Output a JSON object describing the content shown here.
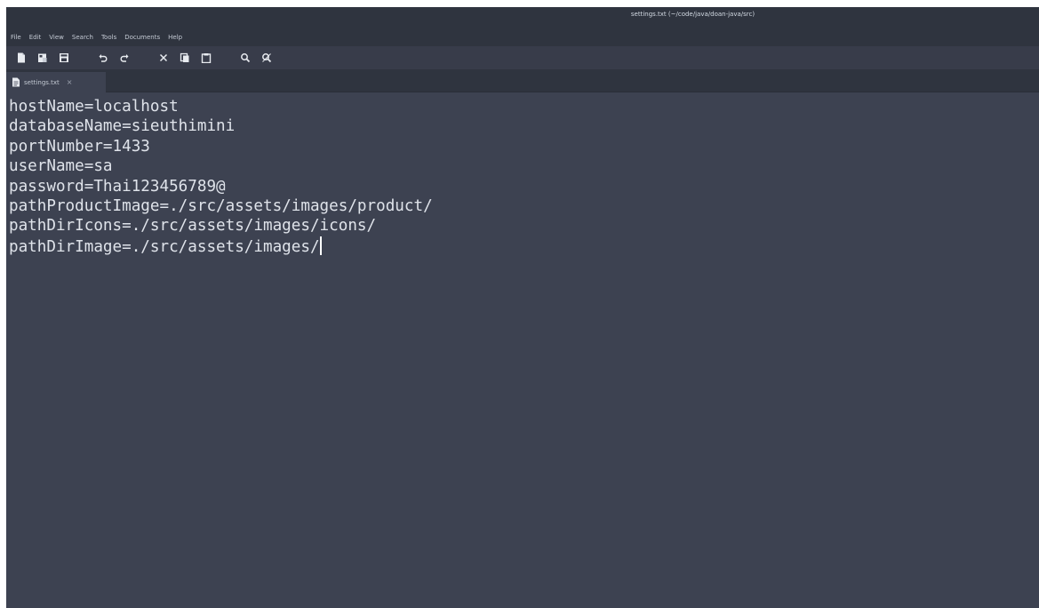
{
  "window": {
    "title": "settings.txt (~/code/java/doan-java/src)"
  },
  "menu": {
    "items": [
      "File",
      "Edit",
      "View",
      "Search",
      "Tools",
      "Documents",
      "Help"
    ]
  },
  "toolbar": {
    "buttons": [
      {
        "icon": "new-document-icon"
      },
      {
        "icon": "open-document-icon"
      },
      {
        "icon": "save-icon"
      },
      {
        "icon": "undo-icon"
      },
      {
        "icon": "redo-icon"
      },
      {
        "icon": "cut-icon"
      },
      {
        "icon": "copy-icon"
      },
      {
        "icon": "paste-icon"
      },
      {
        "icon": "search-icon"
      },
      {
        "icon": "search-replace-icon"
      }
    ]
  },
  "tab": {
    "label": "settings.txt",
    "close": "×",
    "icon": "text-file-icon"
  },
  "editor": {
    "lines": [
      "hostName=localhost",
      "databaseName=sieuthimini",
      "portNumber=1433",
      "userName=sa",
      "password=Thai123456789@",
      "pathProductImage=./src/assets/images/product/",
      "pathDirIcons=./src/assets/images/icons/",
      "pathDirImage=./src/assets/images/"
    ]
  },
  "colors": {
    "editor_bg": "#3d4251",
    "chrome_bg": "#2f343f",
    "toolbar_bg": "#383c4a",
    "text": "#dfe3ea"
  }
}
